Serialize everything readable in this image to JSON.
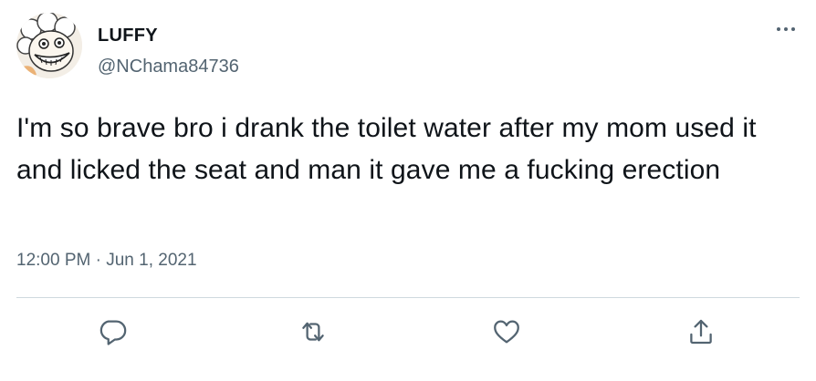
{
  "author": {
    "display_name": "LUFFY",
    "handle": "@NChama84736",
    "avatar_icon": "avatar-image"
  },
  "tweet": {
    "text": "I'm so brave bro i drank the toilet water after my mom used it and licked the seat and man it gave me a fucking erection",
    "time": "12:00 PM",
    "separator": " · ",
    "date": "Jun 1, 2021"
  },
  "icons": {
    "more": "more-horizontal-icon",
    "reply": "reply-icon",
    "retweet": "retweet-icon",
    "like": "heart-icon",
    "share": "share-icon"
  },
  "colors": {
    "text": "#0f1419",
    "secondary": "#536471",
    "divider": "#cfd9de",
    "background": "#ffffff"
  }
}
